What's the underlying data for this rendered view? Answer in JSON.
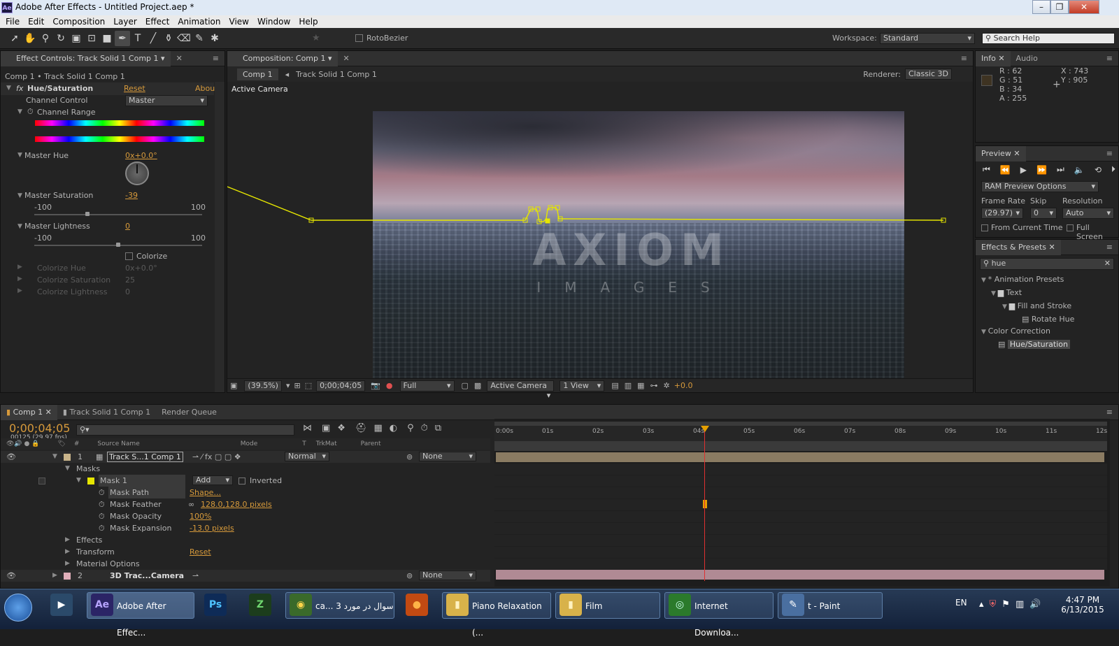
{
  "window": {
    "title": "Adobe After Effects - Untitled Project.aep *",
    "app_icon": "Ae"
  },
  "menu": [
    "File",
    "Edit",
    "Composition",
    "Layer",
    "Effect",
    "Animation",
    "View",
    "Window",
    "Help"
  ],
  "toolbar": {
    "rotobezier": "RotoBezier",
    "workspace_label": "Workspace:",
    "workspace_value": "Standard",
    "search_placeholder": "Search Help"
  },
  "effect_controls": {
    "tab": "Effect Controls: Track Solid 1 Comp 1",
    "breadcrumb": "Comp 1 • Track Solid 1 Comp 1",
    "effect_name": "Hue/Saturation",
    "reset": "Reset",
    "about": "Abou",
    "channel_control_label": "Channel Control",
    "channel_control_value": "Master",
    "channel_range": "Channel Range",
    "master_hue_label": "Master Hue",
    "master_hue_value": "0x+0.0°",
    "master_sat_label": "Master Saturation",
    "master_sat_value": "-39",
    "sat_min": "-100",
    "sat_max": "100",
    "master_light_label": "Master Lightness",
    "master_light_value": "0",
    "light_min": "-100",
    "light_max": "100",
    "colorize": "Colorize",
    "colorize_hue_label": "Colorize Hue",
    "colorize_hue_value": "0x+0.0°",
    "colorize_sat_label": "Colorize Saturation",
    "colorize_sat_value": "25",
    "colorize_light_label": "Colorize Lightness",
    "colorize_light_value": "0"
  },
  "composition": {
    "tab": "Composition: Comp 1",
    "comp_tab": "Comp 1",
    "layer_crumb": "Track Solid 1 Comp 1",
    "renderer_label": "Renderer:",
    "renderer_value": "Classic 3D",
    "camera_label": "Active Camera",
    "watermark_main": "AXIOM",
    "watermark_sub": "IMAGES",
    "zoom": "(39.5%)",
    "timecode": "0;00;04;05",
    "resolution": "Full",
    "view_camera": "Active Camera",
    "views": "1 View",
    "exposure": "+0.0"
  },
  "info": {
    "tab": "Info",
    "tab2": "Audio",
    "r": "R : 62",
    "g": "G : 51",
    "b": "B : 34",
    "a": "A : 255",
    "x": "X : 743",
    "y": "Y : 905",
    "swatch": "#3e3322"
  },
  "preview": {
    "tab": "Preview",
    "ram": "RAM Preview Options",
    "frame_rate_label": "Frame Rate",
    "skip_label": "Skip",
    "resolution_label": "Resolution",
    "frame_rate": "(29.97)",
    "skip": "0",
    "resolution": "Auto",
    "from_current": "From Current Time",
    "full_screen": "Full Screen"
  },
  "effects_presets": {
    "tab": "Effects & Presets",
    "search": "hue",
    "items": [
      {
        "label": "* Animation Presets",
        "indent": 0
      },
      {
        "label": "Text",
        "indent": 1
      },
      {
        "label": "Fill and Stroke",
        "indent": 2
      },
      {
        "label": "Rotate Hue",
        "indent": 3
      },
      {
        "label": "Color Correction",
        "indent": 0
      },
      {
        "label": "Hue/Saturation",
        "indent": 1
      }
    ]
  },
  "timeline": {
    "tabs": [
      "Comp 1",
      "Track Solid 1 Comp 1",
      "Render Queue"
    ],
    "timecode": "0;00;04;05",
    "frames": "00125 (29.97 fps)",
    "columns": {
      "num": "#",
      "source": "Source Name",
      "mode": "Mode",
      "t": "T",
      "trkmat": "TrkMat",
      "parent": "Parent"
    },
    "ruler": [
      "0:00s",
      "01s",
      "02s",
      "03s",
      "04s",
      "05s",
      "06s",
      "07s",
      "08s",
      "09s",
      "10s",
      "11s",
      "12s"
    ],
    "layer1": {
      "num": "1",
      "name": "Track S...1 Comp 1",
      "mode": "Normal",
      "parent": "None"
    },
    "masks": "Masks",
    "mask1": {
      "name": "Mask 1",
      "mode": "Add",
      "inverted": "Inverted"
    },
    "mask_props": [
      {
        "label": "Mask Path",
        "value": "Shape..."
      },
      {
        "label": "Mask Feather",
        "value": "128.0,128.0 pixels"
      },
      {
        "label": "Mask Opacity",
        "value": "100%"
      },
      {
        "label": "Mask Expansion",
        "value": "-13.0 pixels"
      }
    ],
    "effects": "Effects",
    "transform": "Transform",
    "transform_reset": "Reset",
    "material": "Material Options",
    "layer2": {
      "num": "2",
      "name": "3D Trac...Camera",
      "parent": "None"
    }
  },
  "taskbar": {
    "items": [
      {
        "label": "Adobe After Effec...",
        "icon": "Ae",
        "color": "#2b2466"
      },
      {
        "label": "",
        "icon": "Ps",
        "color": "#0e2b57"
      },
      {
        "label": "",
        "icon": "Z",
        "color": "#1c3d1c"
      },
      {
        "label": "ca... سوال در مورد 3",
        "icon": "◉",
        "color": "#3a6a2a"
      },
      {
        "label": "",
        "icon": "●",
        "color": "#c24a12"
      },
      {
        "label": "Piano Relaxation (...",
        "icon": "▮",
        "color": "#d8b24a"
      },
      {
        "label": "Film",
        "icon": "▮",
        "color": "#d8b24a"
      },
      {
        "label": "Internet Downloa...",
        "icon": "◎",
        "color": "#2b7a2b"
      },
      {
        "label": "t - Paint",
        "icon": "✎",
        "color": "#4a6fa0"
      }
    ],
    "lang": "EN",
    "time": "4:47 PM",
    "date": "6/13/2015"
  }
}
